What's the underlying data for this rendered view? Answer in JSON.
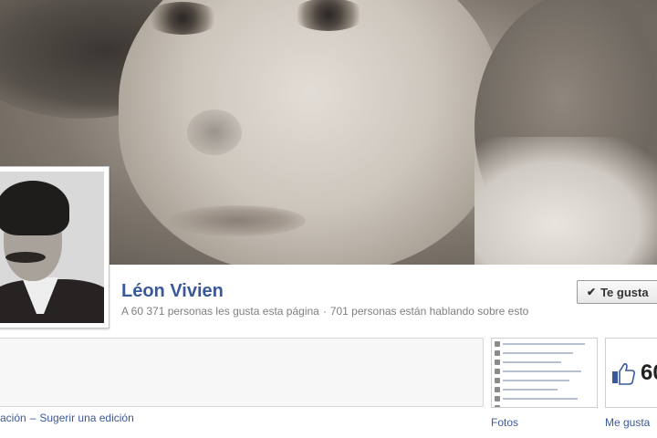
{
  "page": {
    "name": "Léon Vivien",
    "likes_text": "A 60 371 personas les gusta esta página",
    "separator": "·",
    "talking_text": "701 personas están hablando sobre esto"
  },
  "like_button": {
    "label": "Te gusta",
    "check": "✔"
  },
  "info": {
    "link_1": "ación",
    "separator": "–",
    "link_2": "Sugerir una edición"
  },
  "photos": {
    "label": "Fotos"
  },
  "likes_box": {
    "count": "60",
    "label": "Me gusta"
  },
  "colors": {
    "link": "#3b5998",
    "stats": "#7f7f7f"
  }
}
